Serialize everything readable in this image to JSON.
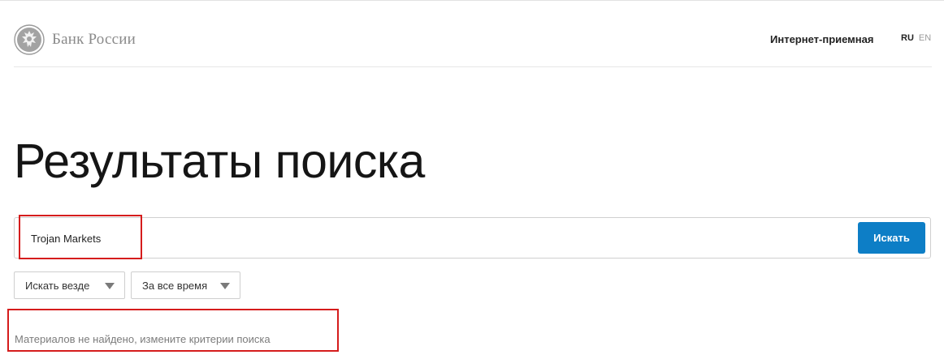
{
  "header": {
    "logo_text": "Банк России",
    "reception_link": "Интернет-приемная",
    "languages": {
      "ru": "RU",
      "en": "EN"
    }
  },
  "main": {
    "title": "Результаты поиска",
    "search": {
      "value": "Trojan Markets",
      "button_label": "Искать"
    },
    "filters": {
      "scope": "Искать везде",
      "period": "За все время"
    },
    "no_results_text": "Материалов не найдено, измените критерии поиска"
  },
  "colors": {
    "accent": "#0d7ec6",
    "highlight": "#d51c1c",
    "muted_text": "#7c7c7c"
  },
  "icons": [
    "bank-emblem-icon",
    "dropdown-caret-icon"
  ]
}
